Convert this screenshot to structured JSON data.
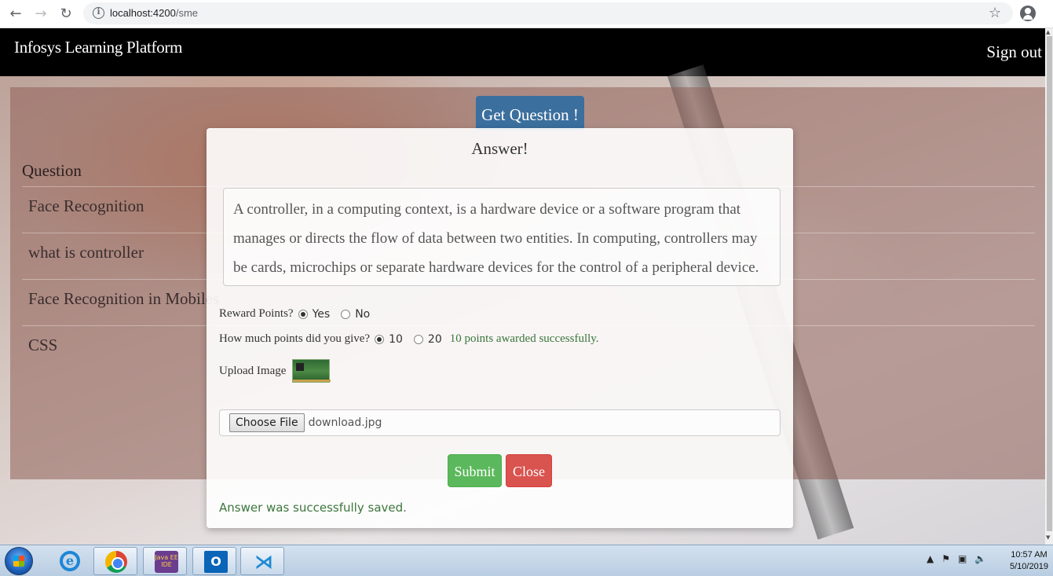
{
  "browser": {
    "url_host": "localhost:4200",
    "url_path": "/sme"
  },
  "navbar": {
    "brand": "Infosys Learning Platform",
    "signout": "Sign out"
  },
  "page": {
    "get_question_label": "Get Question !",
    "question_heading": "Question",
    "questions": [
      "Face Recognition",
      "what is controller",
      "Face Recognition in Mobiles",
      "CSS"
    ]
  },
  "modal": {
    "title": "Answer!",
    "answer_text": "A controller, in a computing context, is a hardware device or a software program that manages or directs the flow of data between two entities. In computing, controllers may be cards, microchips or separate hardware devices for the control of a peripheral device.",
    "reward_label": "Reward Points?",
    "reward_options": [
      "Yes",
      "No"
    ],
    "reward_selected": "Yes",
    "points_label": "How much points did you give?",
    "points_options": [
      "10",
      "20"
    ],
    "points_selected": "10",
    "points_success": "10 points awarded successfully.",
    "upload_label": "Upload Image",
    "choose_file_label": "Choose File",
    "file_name": "download.jpg",
    "submit_label": "Submit",
    "close_label": "Close",
    "saved_message": "Answer was successfully saved."
  },
  "taskbar": {
    "java_icon_text": "Java EE IDE",
    "outlook_icon_text": "O",
    "clock_time": "10:57 AM",
    "clock_date": "5/10/2019"
  },
  "colors": {
    "success": "#3c763d",
    "submit": "#5cb85c",
    "close": "#d9534f",
    "get_question": "#3b6f9d"
  }
}
